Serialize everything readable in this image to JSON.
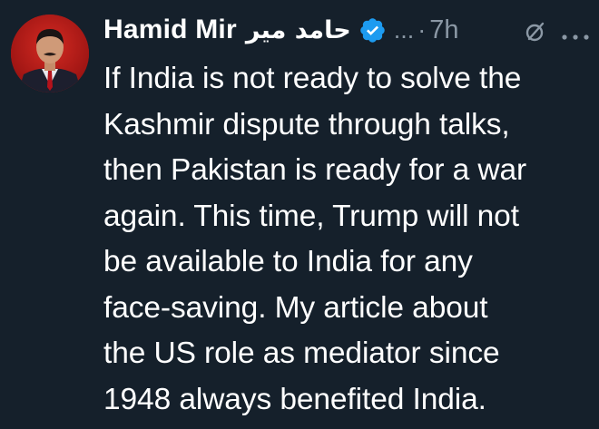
{
  "tweet": {
    "author_name": "Hamid Mir",
    "author_name_urdu": "حامد میر",
    "handle": "...",
    "separator": "·",
    "time": "7h",
    "lines": [
      "If India is not ready to solve the",
      "Kashmir dispute through talks,",
      "then Pakistan is ready for a war",
      "again. This time, Trump will not",
      "be available to India for any",
      "face-saving. My article about",
      "the US role as mediator since",
      "1948 always benefited India."
    ]
  },
  "icons": {
    "avatar": "profile-photo",
    "verified": "verified-badge-icon",
    "grok": "grok-icon",
    "more": "more-options-icon"
  },
  "colors": {
    "background": "#15202b",
    "text": "#ffffff",
    "secondary": "#8b98a5",
    "verified": "#1d9bf0"
  }
}
